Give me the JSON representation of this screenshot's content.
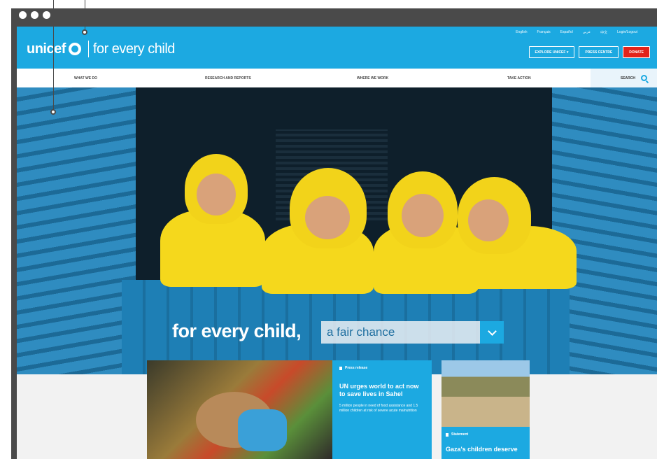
{
  "brand": {
    "name": "unicef",
    "tagline": "for every child"
  },
  "languages": [
    "English",
    "Français",
    "Español",
    "عربي",
    "中文",
    "Login/Logout"
  ],
  "top_buttons": {
    "explore": "EXPLORE UNICEF ▾",
    "press": "PRESS CENTRE",
    "donate": "DONATE"
  },
  "nav": {
    "items": [
      "WHAT WE DO",
      "RESEARCH AND REPORTS",
      "WHERE WE WORK",
      "TAKE ACTION"
    ],
    "search_label": "SEARCH"
  },
  "hero": {
    "title": "for every child,",
    "dropdown_value": "a fair chance"
  },
  "cards": {
    "news": {
      "tag": "Press release",
      "headline": "UN urges world to act now to save lives in Sahel",
      "body": "5 million people in need of food assistance and 1.5 million children at risk of severe acute malnutrition"
    },
    "small": {
      "tag": "Statement",
      "headline": "Gaza's children deserve"
    }
  },
  "colors": {
    "brand_blue": "#1ca9e1",
    "donate_red": "#e2231a",
    "hood_yellow": "#f2d31a"
  },
  "icons": [
    "unicef-globe-icon",
    "search-icon",
    "chevron-down-icon",
    "document-icon"
  ]
}
